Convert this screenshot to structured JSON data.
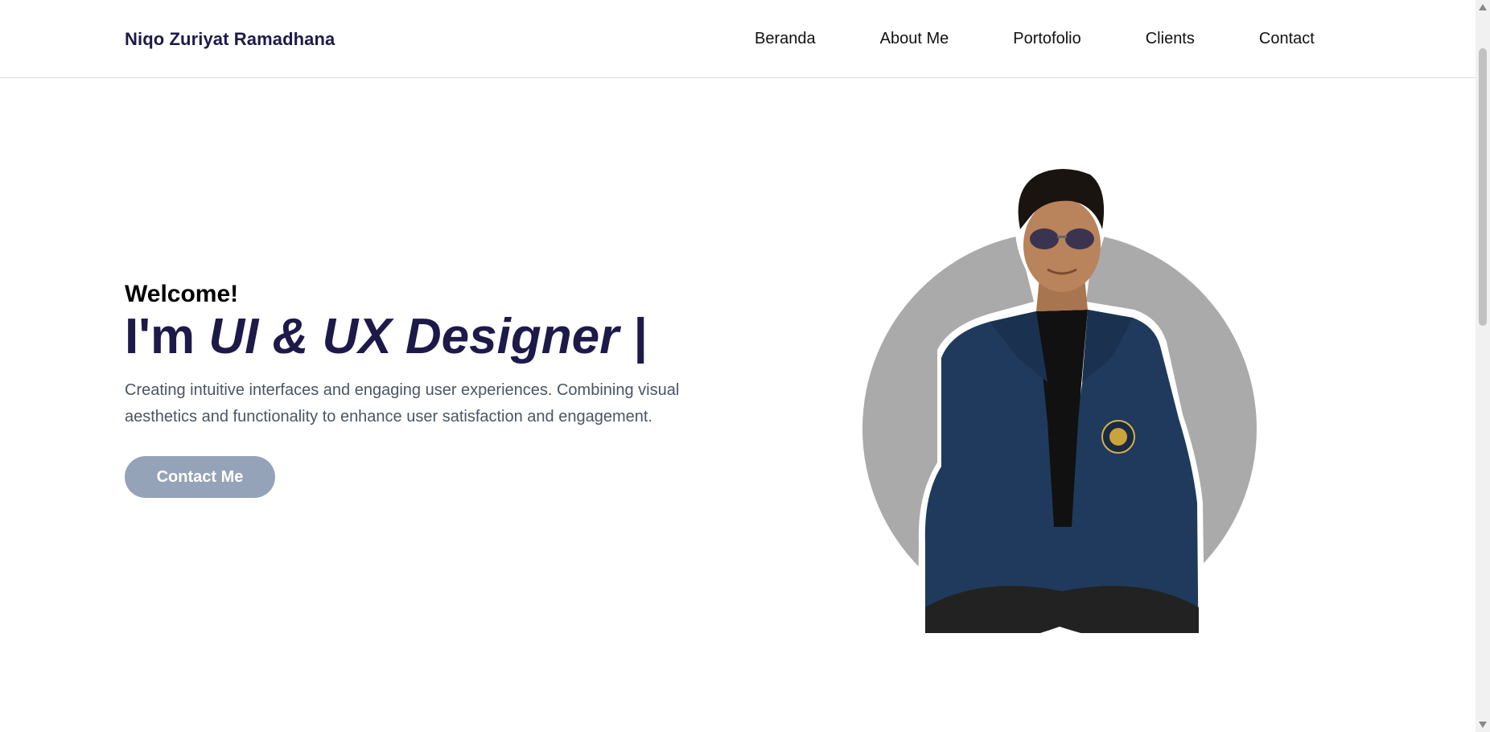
{
  "header": {
    "brand": "Niqo Zuriyat Ramadhana",
    "nav": [
      {
        "label": "Beranda"
      },
      {
        "label": "About Me"
      },
      {
        "label": "Portofolio"
      },
      {
        "label": "Clients"
      },
      {
        "label": "Contact"
      }
    ]
  },
  "hero": {
    "welcome": "Welcome!",
    "headline_prefix": "I'm ",
    "headline_role": "UI & UX Designer |",
    "description": "Creating intuitive interfaces and engaging user experiences. Combining visual aesthetics and functionality to enhance user satisfaction and engagement.",
    "cta_label": "Contact Me"
  },
  "colors": {
    "brand_navy": "#1d1a4a",
    "cta_bg": "#94a3b8",
    "portrait_circle": "#aaaaaa",
    "jacket": "#1f3a5c"
  },
  "icons": {
    "scroll_up": "triangle-up-icon",
    "scroll_down": "triangle-down-icon"
  }
}
